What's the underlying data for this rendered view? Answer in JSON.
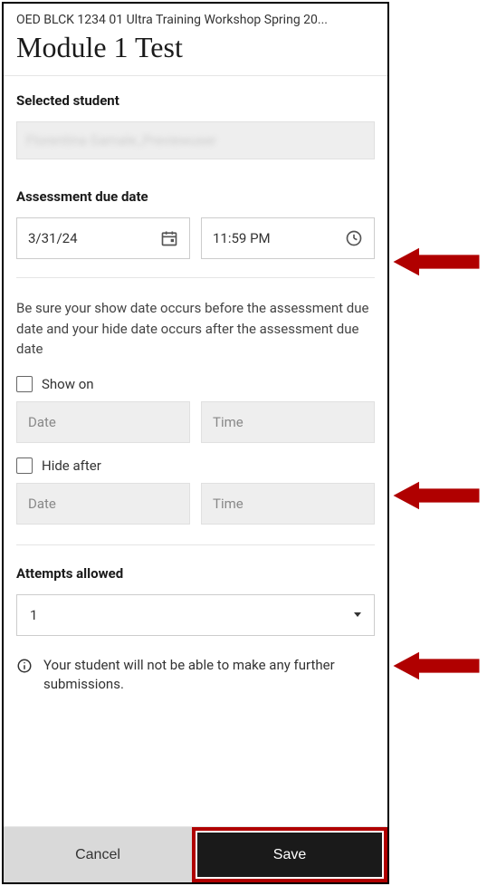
{
  "header": {
    "breadcrumb": "OED BLCK 1234 01 Ultra Training Workshop Spring 20...",
    "title": "Module 1 Test"
  },
  "student": {
    "label": "Selected student",
    "name_blurred": "Florentina Gamale_Previewuser"
  },
  "due": {
    "label": "Assessment due date",
    "date": "3/31/24",
    "time": "11:59 PM"
  },
  "visibility": {
    "hint": "Be sure your show date occurs before the assessment due date and your hide date occurs after the assessment due date",
    "show_on_label": "Show on",
    "hide_after_label": "Hide after",
    "date_placeholder": "Date",
    "time_placeholder": "Time"
  },
  "attempts": {
    "label": "Attempts allowed",
    "value": "1",
    "info": "Your student will not be able to make any further submissions."
  },
  "buttons": {
    "cancel": "Cancel",
    "save": "Save"
  },
  "colors": {
    "highlight": "#b00000"
  }
}
